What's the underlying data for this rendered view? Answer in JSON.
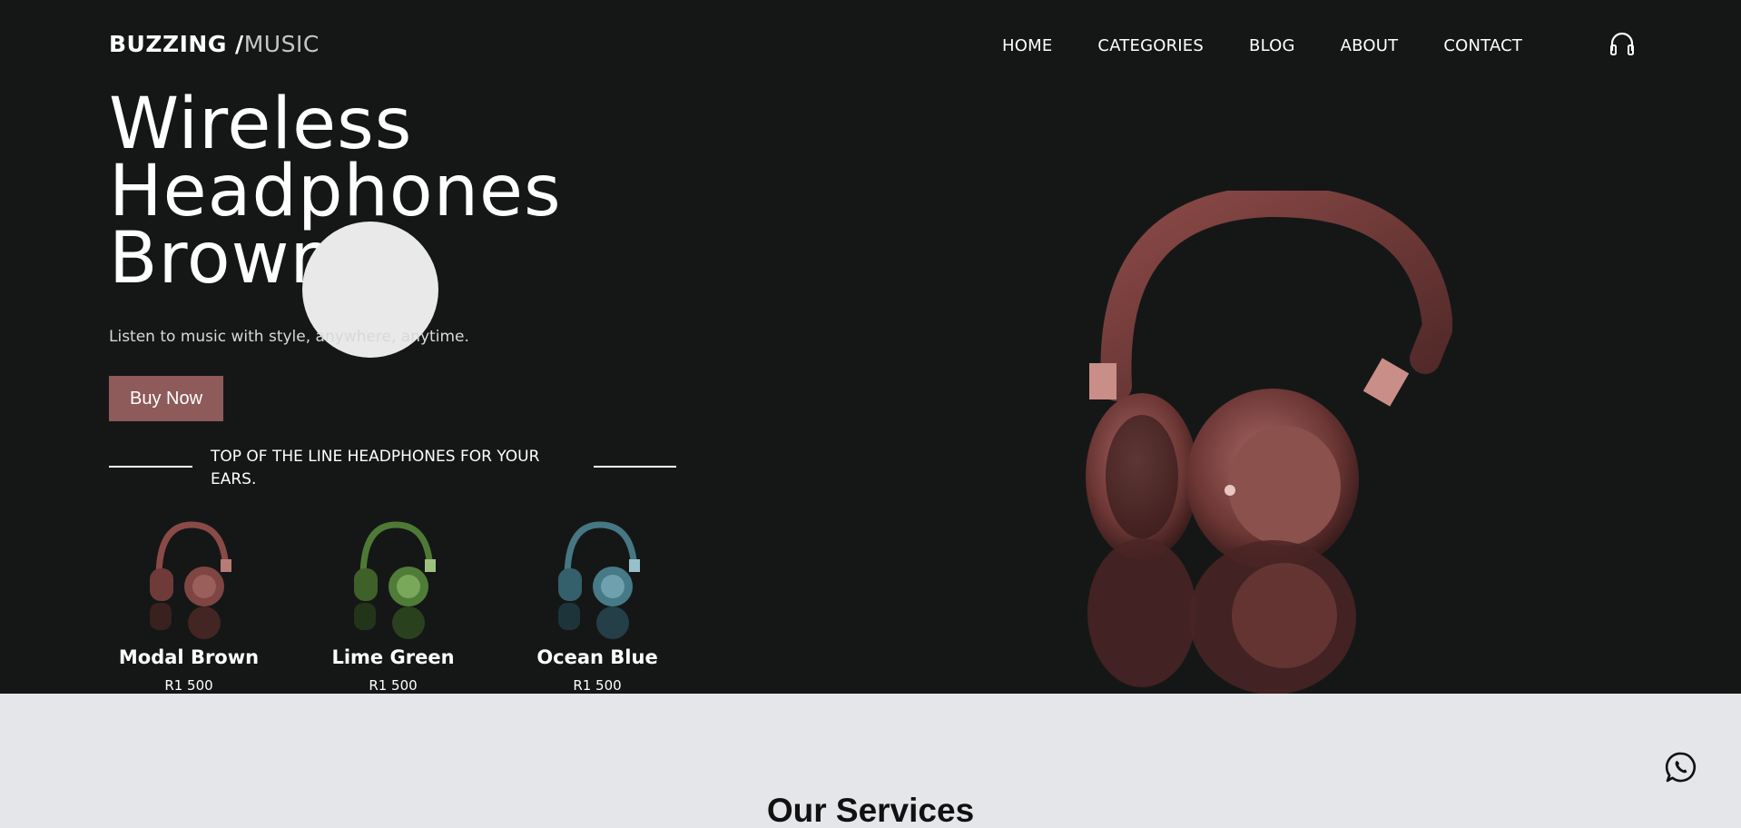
{
  "brand": {
    "strong": "BUZZING /",
    "light": "MUSIC"
  },
  "nav": {
    "items": [
      "HOME",
      "CATEGORIES",
      "BLOG",
      "ABOUT",
      "CONTACT"
    ]
  },
  "hero": {
    "title_lines": [
      "Wireless",
      "Headphones",
      "Brown"
    ],
    "subtitle": "Listen to music with style, anywhere, anytime.",
    "cta_label": "Buy Now",
    "tagline": "TOP OF THE LINE HEADPHONES FOR YOUR EARS."
  },
  "products": [
    {
      "name": "Modal Brown",
      "price": "R1 500",
      "color": "#8a4a47"
    },
    {
      "name": "Lime Green",
      "price": "R1 500",
      "color": "#5a8a3e"
    },
    {
      "name": "Ocean Blue",
      "price": "R1 500",
      "color": "#4a7f8c"
    }
  ],
  "services": {
    "title": "Our Services"
  },
  "icons": {
    "cart": "headphones-icon",
    "chat": "whatsapp-icon"
  },
  "colors": {
    "hero_bg": "#151717",
    "accent": "#8e5a5a",
    "page_bg": "#e5e6ea",
    "headphone": "#7a3d3b"
  }
}
